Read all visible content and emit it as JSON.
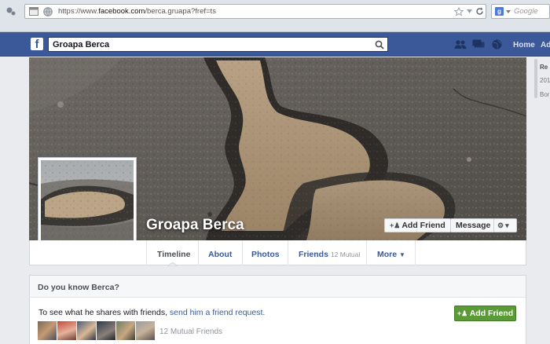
{
  "browser": {
    "url_prefix": "https://www.",
    "url_domain": "facebook.com",
    "url_path": "/berca.gruapa?fref=ts",
    "search_engine_placeholder": "Google"
  },
  "header": {
    "logo": "f",
    "search_value": "Groapa Berca",
    "nav_links": [
      "Home",
      "Ad"
    ]
  },
  "profile": {
    "name": "Groapa Berca",
    "add_friend_label": "Add Friend",
    "message_label": "Message"
  },
  "tabs": [
    {
      "label": "Timeline"
    },
    {
      "label": "About"
    },
    {
      "label": "Photos"
    },
    {
      "label": "Friends",
      "sub": "12 Mutual"
    },
    {
      "label": "More"
    }
  ],
  "know_box": {
    "title": "Do you know Berca?",
    "text_before": "To see what he shares with friends, ",
    "link_text": "send him a friend request.",
    "button_label": "Add Friend",
    "mutual_friends": "12 Mutual Friends"
  },
  "right_column": {
    "items": [
      "Re",
      "201",
      "Bor"
    ]
  },
  "colors": {
    "brand_blue": "#3b5998",
    "green_button": "#5b9b37"
  }
}
